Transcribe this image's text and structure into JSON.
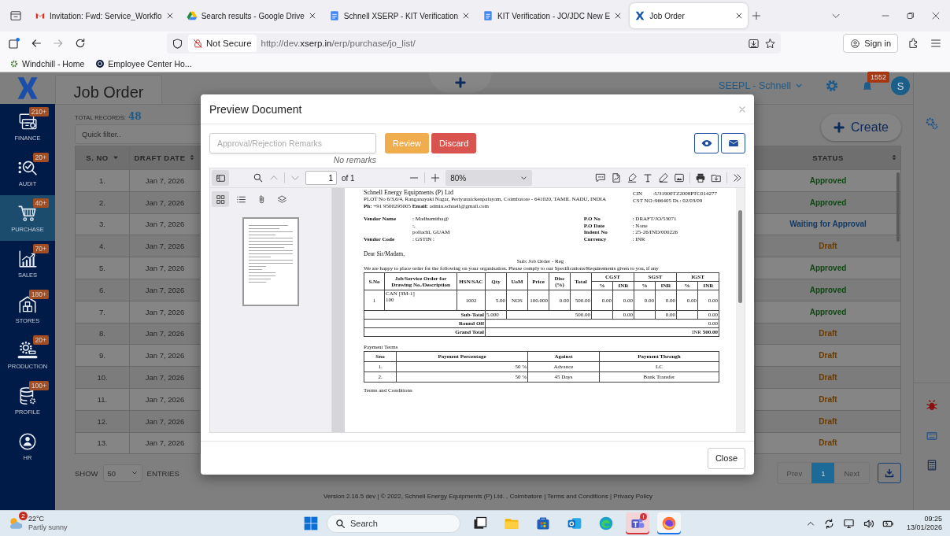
{
  "browser": {
    "tabs": [
      {
        "title": "Invitation: Fwd: Service_Workflo",
        "selected": false
      },
      {
        "title": "Search results - Google Drive",
        "selected": false
      },
      {
        "title": "Schnell XSERP - KIT Verification",
        "selected": false
      },
      {
        "title": "KIT Verification - JO/JDC New E",
        "selected": false
      },
      {
        "title": "Job Order",
        "selected": true
      }
    ],
    "security": "Not Secure",
    "url": "http://dev.**xserp.in**/erp/purchase/jo_list/",
    "sign_in": "Sign in",
    "bookmarks": [
      {
        "label": "Windchill - Home"
      },
      {
        "label": "Employee Center Ho..."
      }
    ]
  },
  "sidebar": {
    "items": [
      {
        "label": "FINANCE",
        "badge": "210+",
        "selected": false
      },
      {
        "label": "AUDIT",
        "badge": "20+",
        "selected": false
      },
      {
        "label": "PURCHASE",
        "badge": "40+",
        "selected": true
      },
      {
        "label": "SALES",
        "badge": "70+",
        "selected": false
      },
      {
        "label": "STORES",
        "badge": "180+",
        "selected": false
      },
      {
        "label": "PRODUCTION",
        "badge": "20+",
        "selected": false
      },
      {
        "label": "PROFILE",
        "badge": "100+",
        "selected": false
      },
      {
        "label": "HR",
        "selected": false
      }
    ]
  },
  "header": {
    "title": "Job Order",
    "company": "SEEPL - Schnell",
    "notifications": "1552",
    "avatar": "S"
  },
  "list": {
    "total_label": "TOTAL RECORDS:",
    "total": "48",
    "filter_placeholder": "Quick filter..",
    "create": "Create"
  },
  "table": {
    "columns": [
      {
        "label": "S. NO"
      },
      {
        "label": "DRAFT DATE"
      },
      {
        "label": "STATUS"
      }
    ],
    "rows": [
      {
        "sno": "1.",
        "date": "Jan 7, 2026",
        "status": "Approved",
        "color": "#0c4a10"
      },
      {
        "sno": "2.",
        "date": "Jan 7, 2026",
        "status": "Approved",
        "color": "#0c4a10"
      },
      {
        "sno": "3.",
        "date": "Jan 7, 2026",
        "status": "Waiting for Approval",
        "color": "#123a66"
      },
      {
        "sno": "4.",
        "date": "Jan 7, 2026",
        "status": "Draft",
        "color": "#6a3a00"
      },
      {
        "sno": "5.",
        "date": "Jan 7, 2026",
        "status": "Approved",
        "color": "#0c4a10"
      },
      {
        "sno": "6.",
        "date": "Jan 7, 2026",
        "status": "Approved",
        "color": "#0c4a10"
      },
      {
        "sno": "7.",
        "date": "Jan 7, 2026",
        "status": "Approved",
        "color": "#0c4a10"
      },
      {
        "sno": "8.",
        "date": "Jan 7, 2026",
        "status": "Draft",
        "color": "#6a3a00"
      },
      {
        "sno": "9.",
        "date": "Jan 7, 2026",
        "status": "Draft",
        "color": "#6a3a00"
      },
      {
        "sno": "10.",
        "date": "Jan 7, 2026",
        "status": "Draft",
        "color": "#6a3a00"
      },
      {
        "sno": "11.",
        "date": "Jan 7, 2026",
        "status": "Draft",
        "color": "#6a3a00"
      },
      {
        "sno": "12.",
        "date": "Jan 7, 2026",
        "status": "Draft",
        "color": "#6a3a00"
      },
      {
        "sno": "13.",
        "date": "Jan 7, 2026",
        "status": "Draft",
        "color": "#6a3a00"
      }
    ]
  },
  "entries": {
    "show": "SHOW",
    "page_size": "50",
    "entries": "ENTRIES"
  },
  "pagination": {
    "prev": {
      "label": "Prev",
      "disabled": true
    },
    "pages": [
      {
        "label": "1",
        "selected": true
      }
    ],
    "next": {
      "label": "Next",
      "disabled": true
    }
  },
  "footer": "Version 2.16.5 dev | © 2022, Schnell Energy Equipments (P) Ltd. , Coimbatore | Terms and Conditions | Privacy Policy",
  "modal": {
    "title": "Preview Document",
    "remarks_placeholder": "Approval/Rejection Remarks",
    "review": "Review",
    "discard": "Discard",
    "no_remarks": "No remarks",
    "close": "Close",
    "pdf": {
      "page": "1",
      "of": "of 1",
      "zoom": "80%",
      "sidebar_tabs": [
        {
          "kind": "thumbnails",
          "selected": true
        },
        {
          "kind": "outline",
          "selected": false
        },
        {
          "kind": "attachments",
          "selected": false
        },
        {
          "kind": "layers",
          "selected": false
        }
      ],
      "document": {
        "company": "Schnell Energy Equipments (P) Ltd",
        "address": "PLOT No 6/3,6/4, Ranganayaki Nagar, Periyanaickenpalayam, Coimbatore - 641020, TAMIL NADU, INDIA",
        "contact": "**Ph:** +91 9500295005 **Email:** admin.schnell@gmail.com",
        "ids": [
          {
            "label": "CIN",
            "value": ":U31900TZ2008PTC014277"
          },
          {
            "label": "CST NO",
            "value": ":966405 Dt.: 02/03/09"
          }
        ],
        "vendor": [
          {
            "label": "Vendor Name",
            "value": ": Madhumitha@"
          },
          {
            "value": ":,"
          },
          {
            "value": "pollachi, GUAM"
          },
          {
            "label": "Vendor Code",
            "value": ": GSTIN :"
          }
        ],
        "order": [
          {
            "label": "P.O No",
            "value": ": DRAFT/JO/53071"
          },
          {
            "label": "P.O Date",
            "value": ": None"
          },
          {
            "label": "Indent No",
            "value": ": 25-26/IND/000226"
          },
          {
            "label": "Currency",
            "value": ": INR"
          }
        ],
        "greeting": "Dear Sir/Madam,",
        "subject": "Sub: Job Order - Reg",
        "intro": "We are happy to place order for the following on your organisation. Please comply to our Specifications/Requirements given to you, if any",
        "columns": [
          "S.No",
          "Job/Service Order for Drawing No./Description",
          "HSN/SAC",
          "Qty",
          "UoM",
          "Price",
          "Disc (%)",
          "Total"
        ],
        "tax_groups": [
          {
            "name": "CGST",
            "subheads": [
              "%",
              "INR"
            ]
          },
          {
            "name": "SGST",
            "subheads": [
              "%",
              "INR"
            ]
          },
          {
            "name": "IGST",
            "subheads": [
              "%",
              "INR"
            ]
          }
        ],
        "items": [
          {
            "sno": "1",
            "description": [
              "CAN [3M-1]",
              "100"
            ],
            "hsn": "1002",
            "qty": "5.00",
            "uom": "NOS",
            "price": "100.000",
            "disc": "0.00",
            "total": "500.00",
            "taxes": [
              "0.00",
              "0.00",
              "0.00",
              "0.00",
              "0.00",
              "0.00"
            ]
          }
        ],
        "subtotal": {
          "label": "Sub-Total",
          "qty": "5.000",
          "total": "500.00",
          "taxes": [
            "0.00",
            "0.00",
            "0.00"
          ]
        },
        "round_off": {
          "label": "Round Off",
          "value": "0.00"
        },
        "grand_total": {
          "label": "Grand Total",
          "value": "INR **500.00**"
        },
        "payment_title": "Payment Terms",
        "payment_columns": [
          "Sno",
          "Payment Percentage",
          "Against",
          "Payment Through"
        ],
        "payments": [
          {
            "sno": "1.",
            "percentage": "50 %",
            "against": "Advance",
            "through": "LC"
          },
          {
            "sno": "2.",
            "percentage": "50 %",
            "against": "45 Days",
            "through": "Bank Transfer"
          }
        ],
        "terms": "Terms and Conditions"
      }
    }
  },
  "taskbar": {
    "weather": {
      "badge": "2",
      "temp": "22°C",
      "text": "Partly sunny"
    },
    "search": "Search",
    "apps": [
      {
        "kind": "task-view",
        "selected": false,
        "alert": false
      },
      {
        "kind": "explorer",
        "selected": false,
        "alert": false
      },
      {
        "kind": "store",
        "selected": false,
        "alert": false
      },
      {
        "kind": "outlook",
        "selected": false,
        "alert": false
      },
      {
        "kind": "edge",
        "selected": false,
        "alert": false
      },
      {
        "kind": "teams",
        "selected": false,
        "alert": true
      },
      {
        "kind": "firefox",
        "selected": true,
        "alert": false
      }
    ],
    "time": "09:25",
    "date": "13/01/2026"
  }
}
